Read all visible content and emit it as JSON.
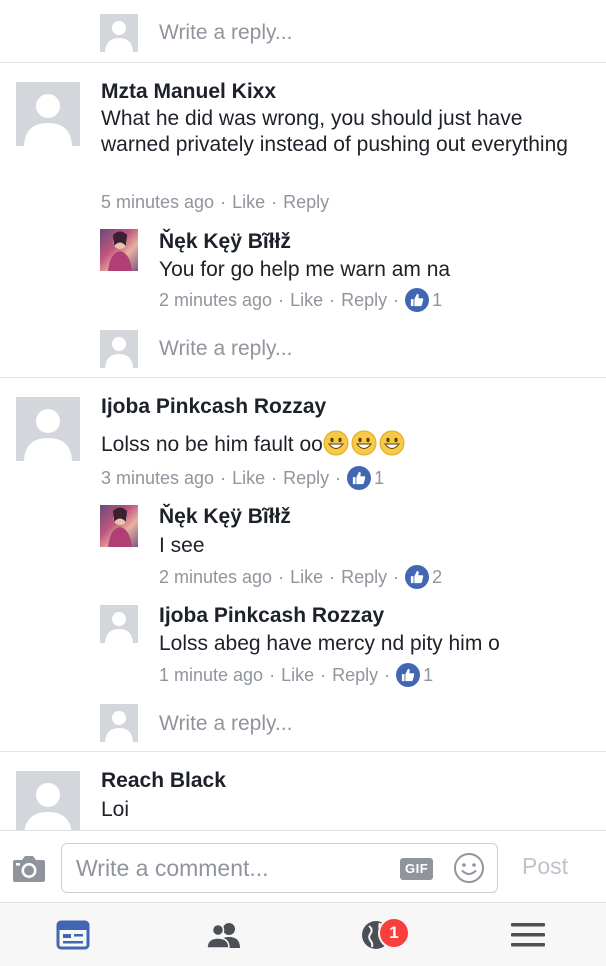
{
  "reply_prompt": "Write a reply...",
  "comments": [
    {
      "author": "Mzta Manuel Kixx",
      "text": "What he did was wrong, you should just have warned privately instead of pushing out everything",
      "time": "5 minutes ago",
      "like_label": "Like",
      "reply_label": "Reply",
      "replies": [
        {
          "author": "Ňęk Kęÿ Bĩłłž",
          "text": "You for go help me warn am na",
          "time": "2 minutes ago",
          "like_label": "Like",
          "reply_label": "Reply",
          "likes": "1"
        }
      ]
    },
    {
      "author": "Ijoba Pinkcash Rozzay",
      "text": "Lolss no be him fault oo",
      "time": "3 minutes ago",
      "like_label": "Like",
      "reply_label": "Reply",
      "likes": "1",
      "replies": [
        {
          "author": "Ňęk Kęÿ Bĩłłž",
          "text": "I see",
          "time": "2 minutes ago",
          "like_label": "Like",
          "reply_label": "Reply",
          "likes": "2"
        },
        {
          "author": "Ijoba Pinkcash Rozzay",
          "text": "Lolss abeg have mercy nd pity him o",
          "time": "1 minute ago",
          "like_label": "Like",
          "reply_label": "Reply",
          "likes": "1"
        }
      ]
    },
    {
      "author": "Reach Black",
      "text": "Loi"
    }
  ],
  "composer": {
    "placeholder": "Write a comment...",
    "gif_label": "GIF",
    "post_label": "Post"
  },
  "tabbar": {
    "notification_count": "1",
    "icons": [
      "news-feed-icon",
      "friends-icon",
      "notifications-globe-icon",
      "menu-icon"
    ]
  },
  "colors": {
    "accent": "#4267b2",
    "meta_text": "#90949c",
    "badge": "#fa3e3e"
  }
}
